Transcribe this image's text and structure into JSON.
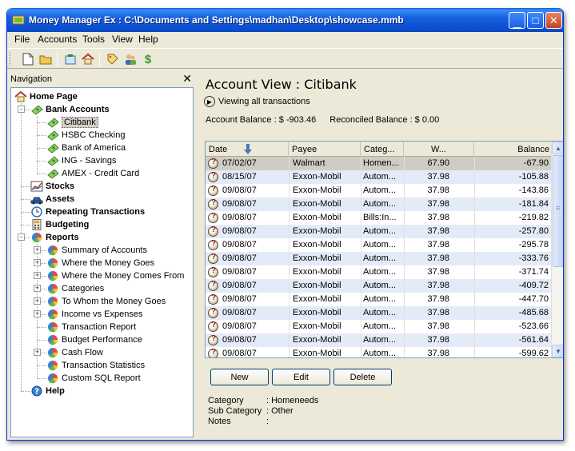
{
  "window": {
    "title": "Money Manager Ex : C:\\Documents and Settings\\madhan\\Desktop\\showcase.mmb"
  },
  "menu": [
    "File",
    "Accounts",
    "Tools",
    "View",
    "Help"
  ],
  "toolbar": {
    "icons": [
      "new-file-icon",
      "open-folder-icon",
      "new-account-icon",
      "home-icon",
      "tag-icon",
      "users-icon",
      "currency-icon"
    ]
  },
  "navigation": {
    "header": "Navigation",
    "close": "✕",
    "items": [
      {
        "label": "Home Page",
        "bold": true,
        "icon": "home-icon"
      },
      {
        "label": "Bank Accounts",
        "bold": true,
        "icon": "money-icon"
      },
      {
        "label": "Citibank",
        "icon": "money-icon"
      },
      {
        "label": "HSBC Checking",
        "icon": "money-icon"
      },
      {
        "label": "Bank of America",
        "icon": "money-icon"
      },
      {
        "label": "ING - Savings",
        "icon": "money-icon"
      },
      {
        "label": "AMEX - Credit Card",
        "icon": "money-icon"
      },
      {
        "label": "Stocks",
        "bold": true,
        "icon": "chart-icon"
      },
      {
        "label": "Assets",
        "bold": true,
        "icon": "car-icon"
      },
      {
        "label": "Repeating Transactions",
        "bold": true,
        "icon": "clock-icon"
      },
      {
        "label": "Budgeting",
        "bold": true,
        "icon": "calculator-icon"
      },
      {
        "label": "Reports",
        "bold": true,
        "icon": "pie-chart-icon"
      },
      {
        "label": "Summary of Accounts",
        "icon": "pie-chart-icon"
      },
      {
        "label": "Where the Money Goes",
        "icon": "pie-chart-icon"
      },
      {
        "label": "Where the Money Comes From",
        "icon": "pie-chart-icon"
      },
      {
        "label": "Categories",
        "icon": "pie-chart-icon"
      },
      {
        "label": "To Whom the Money Goes",
        "icon": "pie-chart-icon"
      },
      {
        "label": "Income vs Expenses",
        "icon": "pie-chart-icon"
      },
      {
        "label": "Transaction Report",
        "icon": "pie-chart-icon"
      },
      {
        "label": "Budget Performance",
        "icon": "pie-chart-icon"
      },
      {
        "label": "Cash Flow",
        "icon": "pie-chart-icon"
      },
      {
        "label": "Transaction Statistics",
        "icon": "pie-chart-icon"
      },
      {
        "label": "Custom SQL Report",
        "icon": "pie-chart-icon"
      },
      {
        "label": "Help",
        "bold": true,
        "icon": "help-icon"
      }
    ]
  },
  "account_view": {
    "title": "Account View : Citibank",
    "filter": "Viewing all transactions",
    "balance": "Account Balance : $ -903.46",
    "reconciled": "Reconciled Balance : $ 0.00",
    "columns": [
      "Date",
      "Payee",
      "Categ...",
      "W...",
      "Balance"
    ],
    "rows": [
      {
        "date": "07/02/07",
        "payee": "Walmart",
        "category": "Homen...",
        "withdrawal": "67.90",
        "balance": "-67.90"
      },
      {
        "date": "08/15/07",
        "payee": "Exxon-Mobil",
        "category": "Autom...",
        "withdrawal": "37.98",
        "balance": "-105.88"
      },
      {
        "date": "09/08/07",
        "payee": "Exxon-Mobil",
        "category": "Autom...",
        "withdrawal": "37.98",
        "balance": "-143.86"
      },
      {
        "date": "09/08/07",
        "payee": "Exxon-Mobil",
        "category": "Autom...",
        "withdrawal": "37.98",
        "balance": "-181.84"
      },
      {
        "date": "09/08/07",
        "payee": "Exxon-Mobil",
        "category": "Bills:In...",
        "withdrawal": "37.98",
        "balance": "-219.82"
      },
      {
        "date": "09/08/07",
        "payee": "Exxon-Mobil",
        "category": "Autom...",
        "withdrawal": "37.98",
        "balance": "-257.80"
      },
      {
        "date": "09/08/07",
        "payee": "Exxon-Mobil",
        "category": "Autom...",
        "withdrawal": "37.98",
        "balance": "-295.78"
      },
      {
        "date": "09/08/07",
        "payee": "Exxon-Mobil",
        "category": "Autom...",
        "withdrawal": "37.98",
        "balance": "-333.76"
      },
      {
        "date": "09/08/07",
        "payee": "Exxon-Mobil",
        "category": "Autom...",
        "withdrawal": "37.98",
        "balance": "-371.74"
      },
      {
        "date": "09/08/07",
        "payee": "Exxon-Mobil",
        "category": "Autom...",
        "withdrawal": "37.98",
        "balance": "-409.72"
      },
      {
        "date": "09/08/07",
        "payee": "Exxon-Mobil",
        "category": "Autom...",
        "withdrawal": "37.98",
        "balance": "-447.70"
      },
      {
        "date": "09/08/07",
        "payee": "Exxon-Mobil",
        "category": "Autom...",
        "withdrawal": "37.98",
        "balance": "-485.68"
      },
      {
        "date": "09/08/07",
        "payee": "Exxon-Mobil",
        "category": "Autom...",
        "withdrawal": "37.98",
        "balance": "-523.66"
      },
      {
        "date": "09/08/07",
        "payee": "Exxon-Mobil",
        "category": "Autom...",
        "withdrawal": "37.98",
        "balance": "-561.64"
      },
      {
        "date": "09/08/07",
        "payee": "Exxon-Mobil",
        "category": "Autom...",
        "withdrawal": "37.98",
        "balance": "-599.62"
      }
    ],
    "buttons": {
      "new": "New",
      "edit": "Edit",
      "delete": "Delete"
    },
    "details": [
      {
        "key": "Category",
        "value": ": Homeneeds"
      },
      {
        "key": "Sub Category",
        "value": ": Other"
      },
      {
        "key": "Notes",
        "value": ":"
      }
    ]
  },
  "colors": {
    "title_bar": "#0a5fd8",
    "row_alt": "#e4ebf8",
    "money_green": "#5aa832"
  }
}
